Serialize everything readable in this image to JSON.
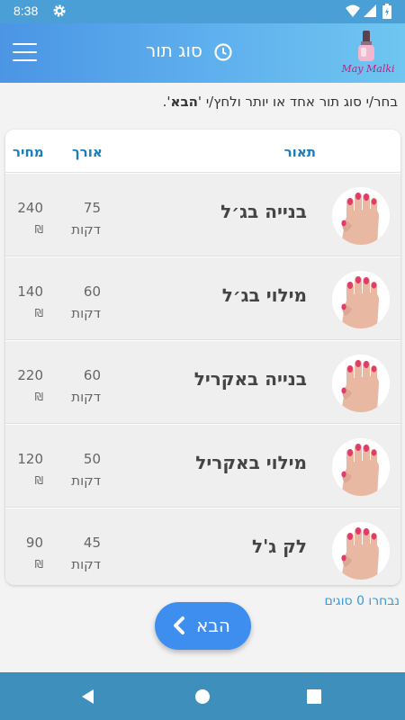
{
  "status_bar": {
    "time": "8:38",
    "icons": [
      "gear-icon",
      "wifi-icon",
      "signal-icon",
      "battery-icon"
    ]
  },
  "app_bar": {
    "title": "סוג תור",
    "title_icon": "clock-icon",
    "menu_icon": "hamburger-icon",
    "logo_text": "May Malki"
  },
  "instruction": {
    "before": "בחר/י סוג תור אחד או יותר ולחץ/י '",
    "bold": "הבא",
    "after": "'."
  },
  "table": {
    "headers": {
      "description": "תאור",
      "length": "אורך",
      "price": "מחיר"
    },
    "rows": [
      {
        "name": "בנייה בג׳ל",
        "length": "75",
        "length_unit": "דקות",
        "price": "240",
        "currency": "₪",
        "image_icon": "nail-hand-image"
      },
      {
        "name": "מילוי בג׳ל",
        "length": "60",
        "length_unit": "דקות",
        "price": "140",
        "currency": "₪",
        "image_icon": "nail-hand-image"
      },
      {
        "name": "בנייה באקריל",
        "length": "60",
        "length_unit": "דקות",
        "price": "220",
        "currency": "₪",
        "image_icon": "nail-hand-image"
      },
      {
        "name": "מילוי באקריל",
        "length": "50",
        "length_unit": "דקות",
        "price": "120",
        "currency": "₪",
        "image_icon": "nail-hand-image"
      },
      {
        "name": "לק ג'ל",
        "length": "45",
        "length_unit": "דקות",
        "price": "90",
        "currency": "₪",
        "image_icon": "nail-hand-image"
      }
    ]
  },
  "selected_count_text": "נבחרו 0 סוגים",
  "next_button": {
    "label": "הבא",
    "icon": "chevron-left-icon"
  },
  "nav_bar": {
    "icons": [
      "back-icon",
      "home-icon",
      "recent-apps-icon"
    ]
  },
  "colors": {
    "accent": "#3e8ef0",
    "header_text": "#1a7ebd",
    "row_background": "#efefef",
    "nail_polish": "#e23a6a"
  }
}
